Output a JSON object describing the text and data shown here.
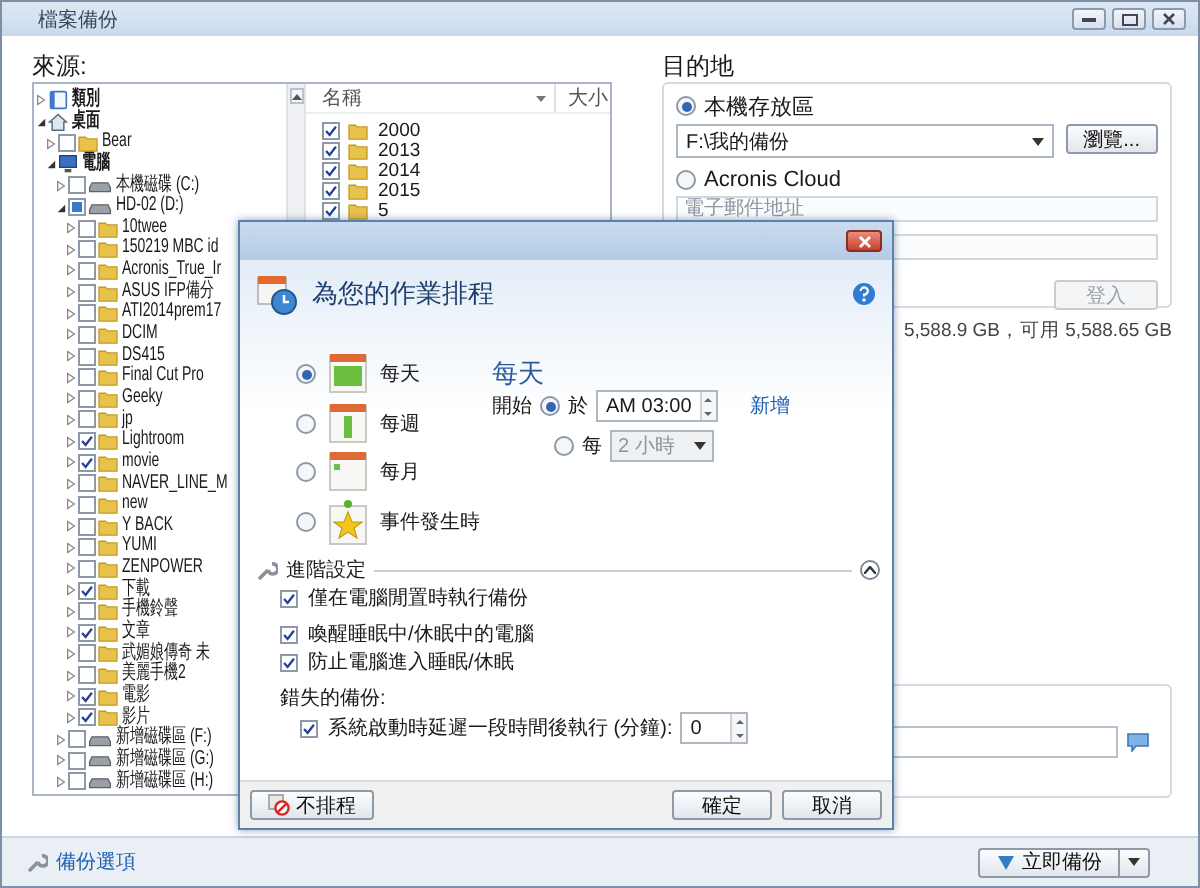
{
  "window": {
    "title": "檔案備份"
  },
  "source": {
    "label": "來源:",
    "tree": [
      {
        "label": "類別",
        "kind": "category",
        "expanded": false
      },
      {
        "label": "桌面",
        "kind": "desktop",
        "expanded": true,
        "children": [
          {
            "label": "Bear",
            "kind": "folder",
            "expanded": false,
            "checked": false
          },
          {
            "label": "電腦",
            "kind": "computer",
            "expanded": true,
            "children": [
              {
                "label": "本機磁碟 (C:)",
                "kind": "drive",
                "expanded": false,
                "checked": false
              },
              {
                "label": "HD-02 (D:)",
                "kind": "drive",
                "expanded": true,
                "checked": false,
                "partial": true,
                "children": [
                  {
                    "label": "10twee",
                    "kind": "folder",
                    "expanded": false,
                    "checked": false
                  },
                  {
                    "label": "150219 MBC id",
                    "kind": "folder",
                    "expanded": false,
                    "checked": false
                  },
                  {
                    "label": "Acronis_True_Ir",
                    "kind": "folder",
                    "expanded": false,
                    "checked": false
                  },
                  {
                    "label": "ASUS IFP備分",
                    "kind": "folder",
                    "expanded": false,
                    "checked": false
                  },
                  {
                    "label": "ATI2014prem17",
                    "kind": "folder",
                    "expanded": false,
                    "checked": false
                  },
                  {
                    "label": "DCIM",
                    "kind": "folder",
                    "expanded": false,
                    "checked": false
                  },
                  {
                    "label": "DS415",
                    "kind": "folder",
                    "expanded": false,
                    "checked": false
                  },
                  {
                    "label": "Final Cut Pro",
                    "kind": "folder",
                    "expanded": false,
                    "checked": false
                  },
                  {
                    "label": "Geeky",
                    "kind": "folder",
                    "expanded": false,
                    "checked": false
                  },
                  {
                    "label": "jp",
                    "kind": "folder",
                    "expanded": false,
                    "checked": false
                  },
                  {
                    "label": "Lightroom",
                    "kind": "folder",
                    "expanded": false,
                    "checked": true
                  },
                  {
                    "label": "movie",
                    "kind": "folder",
                    "expanded": false,
                    "checked": true
                  },
                  {
                    "label": "NAVER_LINE_M",
                    "kind": "folder",
                    "expanded": false,
                    "checked": false
                  },
                  {
                    "label": "new",
                    "kind": "folder",
                    "expanded": false,
                    "checked": false
                  },
                  {
                    "label": "Y BACK",
                    "kind": "folder",
                    "expanded": false,
                    "checked": false
                  },
                  {
                    "label": "YUMI",
                    "kind": "folder",
                    "expanded": false,
                    "checked": false
                  },
                  {
                    "label": "ZENPOWER",
                    "kind": "folder",
                    "expanded": false,
                    "checked": false
                  },
                  {
                    "label": "下載",
                    "kind": "folder",
                    "expanded": false,
                    "checked": true
                  },
                  {
                    "label": "手機鈴聲",
                    "kind": "folder",
                    "expanded": false,
                    "checked": false
                  },
                  {
                    "label": "文章",
                    "kind": "folder",
                    "expanded": false,
                    "checked": true
                  },
                  {
                    "label": "武媚娘傳奇 未",
                    "kind": "folder",
                    "expanded": false,
                    "checked": false
                  },
                  {
                    "label": "美麗手機2",
                    "kind": "folder",
                    "expanded": false,
                    "checked": false
                  },
                  {
                    "label": "電影",
                    "kind": "folder",
                    "expanded": false,
                    "checked": true
                  },
                  {
                    "label": "影片",
                    "kind": "folder",
                    "expanded": false,
                    "checked": true
                  }
                ]
              },
              {
                "label": "新增磁碟區 (F:)",
                "kind": "drive",
                "expanded": false,
                "checked": false
              },
              {
                "label": "新增磁碟區 (G:)",
                "kind": "drive",
                "expanded": false,
                "checked": false
              },
              {
                "label": "新增磁碟區 (H:)",
                "kind": "drive",
                "expanded": false,
                "checked": false
              }
            ]
          }
        ]
      }
    ],
    "list": {
      "columns": [
        "名稱",
        "大小"
      ],
      "items": [
        {
          "name": "2000",
          "checked": true
        },
        {
          "name": "2013",
          "checked": true
        },
        {
          "name": "2014",
          "checked": true
        },
        {
          "name": "2015",
          "checked": true
        },
        {
          "name": "5",
          "checked": true
        }
      ]
    }
  },
  "destination": {
    "label": "目的地",
    "options": [
      {
        "label": "本機存放區",
        "selected": true
      },
      {
        "label": "Acronis Cloud",
        "selected": false
      }
    ],
    "path": "F:\\我的備份",
    "browse_button": "瀏覽...",
    "email": {
      "placeholder": "電子郵件地址"
    },
    "login_button": {
      "label": "登入",
      "disabled": true
    },
    "storage": "5,588.9 GB，可用 5,588.65 GB"
  },
  "backup_options_link": "備份選項",
  "backup_now_button": "立即備份",
  "dialog": {
    "title": "為您的作業排程",
    "frequencies": [
      {
        "label": "每天",
        "kind": "daily",
        "selected": true
      },
      {
        "label": "每週",
        "kind": "weekly",
        "selected": false
      },
      {
        "label": "每月",
        "kind": "monthly",
        "selected": false
      },
      {
        "label": "事件發生時",
        "kind": "event",
        "selected": false
      }
    ],
    "detail": {
      "heading": "每天",
      "start_label": "開始",
      "modes": [
        {
          "label": "於",
          "selected": true,
          "value": "AM 03:00",
          "link": "新增"
        },
        {
          "label": "每",
          "selected": false,
          "value": "2 小時"
        }
      ]
    },
    "advanced": {
      "label": "進階設定",
      "expanded": true,
      "options": [
        {
          "label": "僅在電腦閒置時執行備份",
          "checked": true
        },
        {
          "label": "喚醒睡眠中/休眠中的電腦",
          "checked": true
        },
        {
          "label": "防止電腦進入睡眠/休眠",
          "checked": true
        }
      ],
      "missed_label": "錯失的備份:",
      "delay": {
        "label": "系統啟動時延遲一段時間後執行 (分鐘):",
        "checked": true,
        "value": "0"
      }
    },
    "buttons": {
      "no_schedule": "不排程",
      "ok": "確定",
      "cancel": "取消"
    }
  }
}
